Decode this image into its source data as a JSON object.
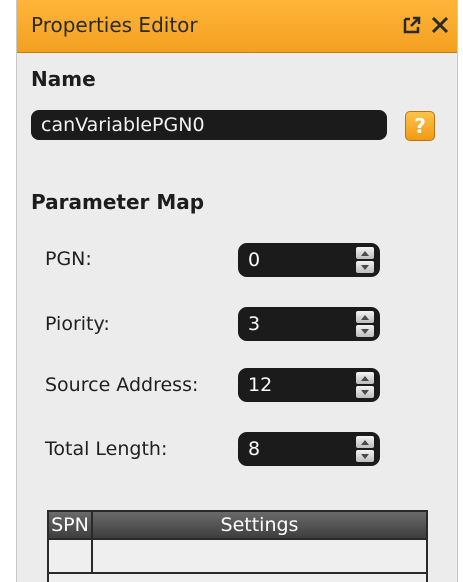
{
  "window": {
    "title": "Properties Editor",
    "icons": [
      "popout-icon",
      "close-icon"
    ]
  },
  "name_section": {
    "label": "Name",
    "value": "canVariablePGN0",
    "help_label": "?"
  },
  "parameter_map": {
    "label": "Parameter Map",
    "rows": [
      {
        "label": "PGN:",
        "value": "0"
      },
      {
        "label": "Piority:",
        "value": "3"
      },
      {
        "label": "Source Address:",
        "value": "12"
      },
      {
        "label": "Total Length:",
        "value": "8"
      }
    ]
  },
  "table": {
    "columns": [
      "SPN",
      "Settings"
    ]
  },
  "colors": {
    "accent": "#f3a020",
    "field_bg": "#1b1b1b",
    "panel_bg": "#ececec"
  }
}
